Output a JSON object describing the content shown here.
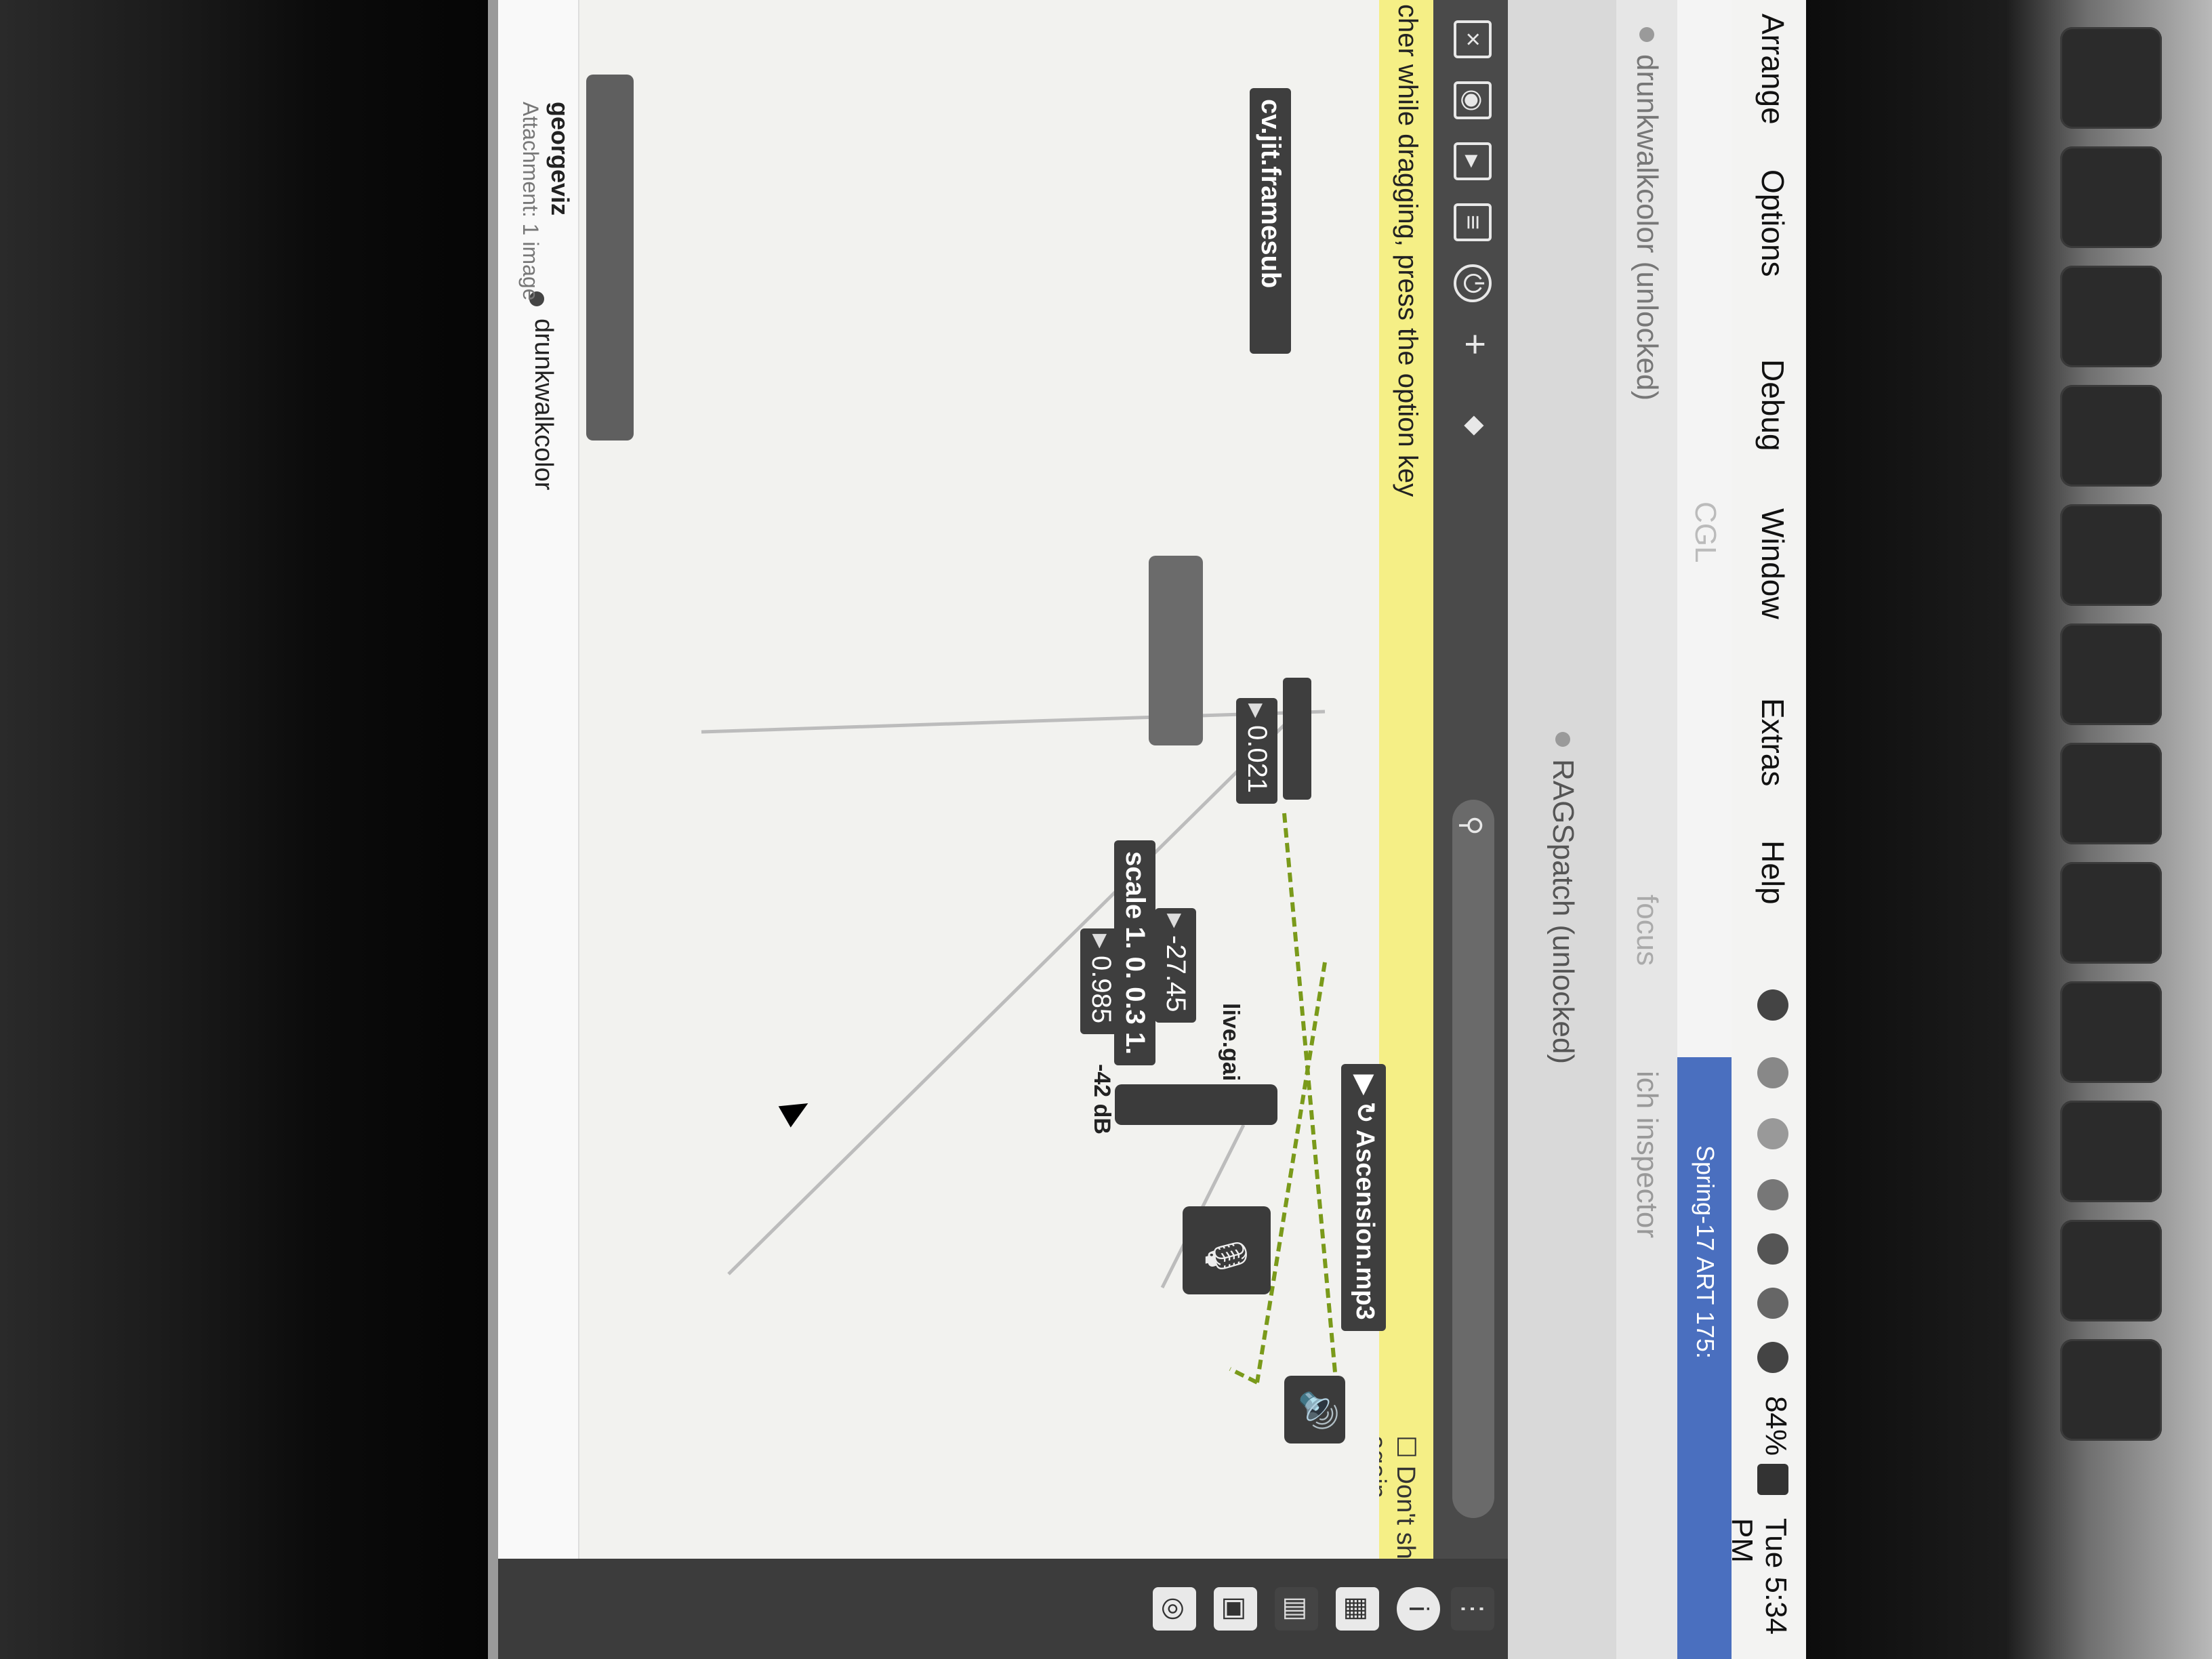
{
  "menubar": {
    "items": [
      "Arrange",
      "Options",
      "Debug",
      "Window",
      "Extras",
      "Help"
    ],
    "battery": "84%",
    "clock": "Tue 5:34 PM"
  },
  "windows": {
    "cgl": "CGL",
    "drunkwalk": "drunkwalkcolor (unlocked)",
    "spring": "Spring-17 ART 175:",
    "inspector": "ich inspector",
    "ragspatch": "RAGSpatch (unlocked)",
    "focus": "focus",
    "drunkwalk_tab": "drunkwalkcolor"
  },
  "hint": {
    "text": "cher while dragging, press the option key",
    "dont_show": "Don't show again"
  },
  "patch": {
    "framesub": "cv.jit.framesub",
    "num1": "0.021",
    "num2": "-27.45",
    "num3": "0.985",
    "scale": "scale 1. 0. 0.3 1.",
    "dbm": "-42 dB",
    "livegain": "live.gai",
    "audiofile": "Ascension.mp3"
  },
  "chat": {
    "user": "georgeviz",
    "attachment": "Attachment: 1 image"
  },
  "colors": {
    "hint_bg": "#f5ef86",
    "patch_cord": "#7a9a1a",
    "object_bg": "#3e3e3e"
  }
}
